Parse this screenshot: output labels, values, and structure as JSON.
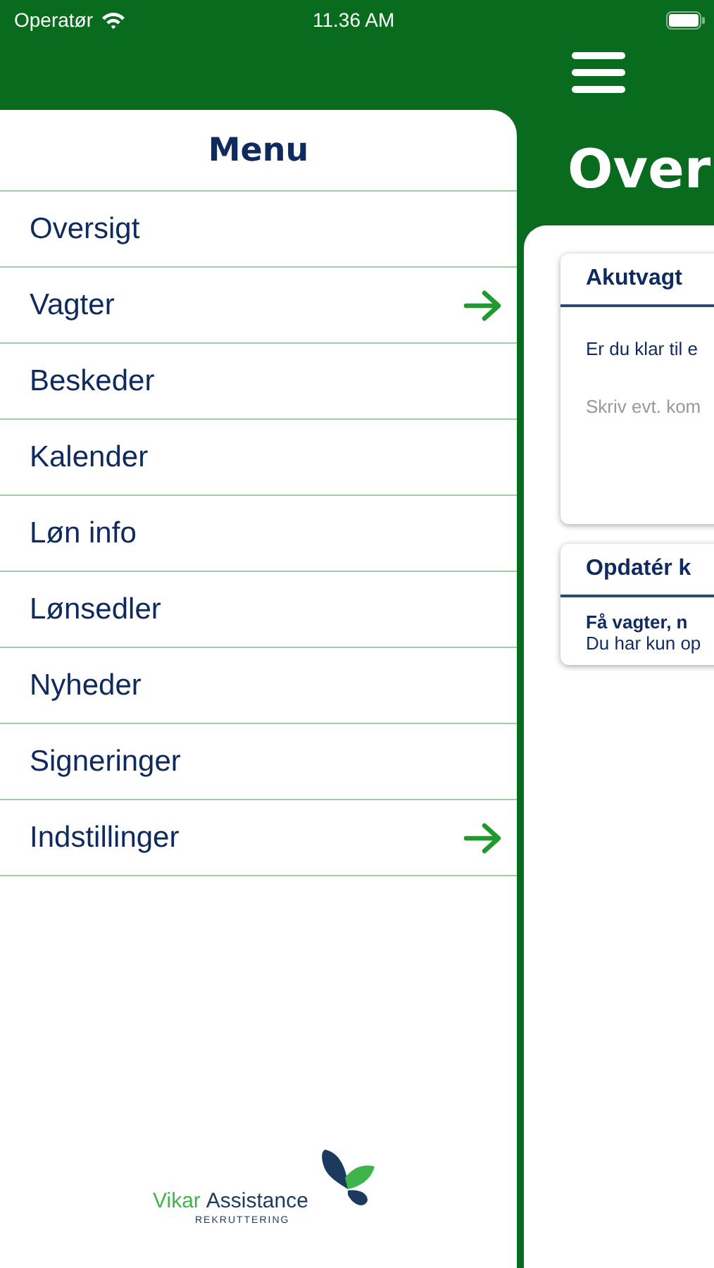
{
  "status_bar": {
    "carrier": "Operatør",
    "time": "11.36 AM"
  },
  "menu": {
    "title": "Menu",
    "items": [
      {
        "label": "Oversigt",
        "has_submenu": false
      },
      {
        "label": "Vagter",
        "has_submenu": true
      },
      {
        "label": "Beskeder",
        "has_submenu": false
      },
      {
        "label": "Kalender",
        "has_submenu": false
      },
      {
        "label": "Løn info",
        "has_submenu": false
      },
      {
        "label": "Lønsedler",
        "has_submenu": false
      },
      {
        "label": "Nyheder",
        "has_submenu": false
      },
      {
        "label": "Signeringer",
        "has_submenu": false
      },
      {
        "label": "Indstillinger",
        "has_submenu": true
      }
    ],
    "logo": {
      "word_1": "Vikar",
      "word_2": "Assistance",
      "tagline": "REKRUTTERING"
    }
  },
  "main": {
    "title": "Over",
    "cards": [
      {
        "title": "Akutvagt",
        "text": "Er du klar til e",
        "placeholder": "Skriv evt. kom"
      },
      {
        "title": "Opdatér k",
        "bold_text": "Få vagter, n",
        "text": "Du har kun op"
      }
    ]
  }
}
